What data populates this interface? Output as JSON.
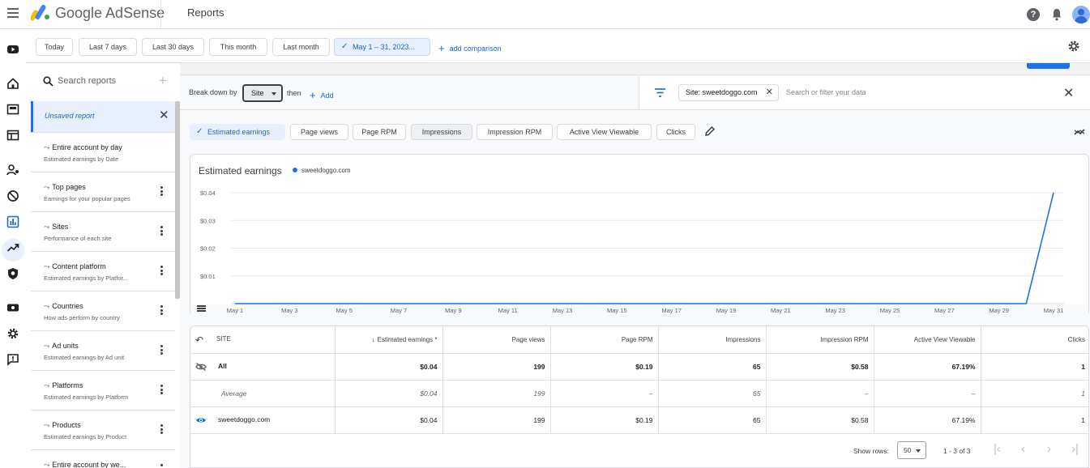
{
  "app": {
    "brand": "Google AdSense",
    "page_title": "Reports"
  },
  "date_bar": {
    "chips": [
      {
        "label": "Today"
      },
      {
        "label": "Last 7 days"
      },
      {
        "label": "Last 30 days"
      },
      {
        "label": "This month"
      },
      {
        "label": "Last month"
      },
      {
        "label": "May 1 – 31, 2023..."
      }
    ],
    "add_comparison": "add comparison"
  },
  "sidebar": {
    "search_label": "Search reports",
    "unsaved_label": "Unsaved report",
    "items": [
      {
        "title": "Entire account by day",
        "subtitle": "Estimated earnings by Date"
      },
      {
        "title": "Top pages",
        "subtitle": "Earnings for your popular pages"
      },
      {
        "title": "Sites",
        "subtitle": "Performance of each site"
      },
      {
        "title": "Content platform",
        "subtitle": "Estimated earnings by Platfor..."
      },
      {
        "title": "Countries",
        "subtitle": "How ads perform by country"
      },
      {
        "title": "Ad units",
        "subtitle": "Estimated earnings by Ad unit"
      },
      {
        "title": "Platforms",
        "subtitle": "Estimated earnings by Platform"
      },
      {
        "title": "Products",
        "subtitle": "Estimated earnings by Product"
      },
      {
        "title": "Entire account by we...",
        "subtitle": ""
      }
    ]
  },
  "breakdown": {
    "label": "Break down by",
    "dimension": "Site",
    "then": "then",
    "add": "Add"
  },
  "filter": {
    "chip": "Site: sweetdoggo.com",
    "placeholder": "Search or filter your data"
  },
  "metrics": [
    {
      "label": "Estimated earnings",
      "selected": true
    },
    {
      "label": "Page views",
      "selected": false
    },
    {
      "label": "Page RPM",
      "selected": false
    },
    {
      "label": "Impressions",
      "selected": false
    },
    {
      "label": "Impression RPM",
      "selected": false
    },
    {
      "label": "Active View Viewable",
      "selected": false
    },
    {
      "label": "Clicks",
      "selected": false
    }
  ],
  "chart": {
    "title": "Estimated earnings",
    "legend": "sweetdoggo.com",
    "series_color": "#1a73e8"
  },
  "chart_data": {
    "type": "line",
    "title": "Estimated earnings",
    "x": [
      "May 1",
      "May 2",
      "May 3",
      "May 4",
      "May 5",
      "May 6",
      "May 7",
      "May 8",
      "May 9",
      "May 10",
      "May 11",
      "May 12",
      "May 13",
      "May 14",
      "May 15",
      "May 16",
      "May 17",
      "May 18",
      "May 19",
      "May 20",
      "May 21",
      "May 22",
      "May 23",
      "May 24",
      "May 25",
      "May 26",
      "May 27",
      "May 28",
      "May 29",
      "May 30",
      "May 31"
    ],
    "x_tick_labels": [
      "May 1",
      "May 3",
      "May 5",
      "May 7",
      "May 9",
      "May 11",
      "May 13",
      "May 15",
      "May 17",
      "May 19",
      "May 21",
      "May 23",
      "May 25",
      "May 27",
      "May 29",
      "May 31"
    ],
    "y_tick_labels": [
      "$0.01",
      "$0.02",
      "$0.03",
      "$0.04"
    ],
    "ylim": [
      0,
      0.04
    ],
    "series": [
      {
        "name": "sweetdoggo.com",
        "values": [
          0,
          0,
          0,
          0,
          0,
          0,
          0,
          0,
          0,
          0,
          0,
          0,
          0,
          0,
          0,
          0,
          0,
          0,
          0,
          0,
          0,
          0,
          0,
          0,
          0,
          0,
          0,
          0,
          0,
          0,
          0.04
        ]
      }
    ],
    "grid": true,
    "legend_position": "top-left"
  },
  "table": {
    "headers": {
      "site": "SITE",
      "earnings": "Estimated earnings *",
      "page_views": "Page views",
      "page_rpm": "Page RPM",
      "impressions": "Impressions",
      "impression_rpm": "Impression RPM",
      "active_view": "Active View Viewable",
      "clicks": "Clicks"
    },
    "rows": [
      {
        "site": "All",
        "earnings": "$0.04",
        "page_views": "199",
        "page_rpm": "$0.19",
        "impressions": "65",
        "impression_rpm": "$0.58",
        "active_view": "67.19%",
        "clicks": "1"
      },
      {
        "site": "Average",
        "earnings": "$0.04",
        "page_views": "199",
        "page_rpm": "–",
        "impressions": "65",
        "impression_rpm": "–",
        "active_view": "–",
        "clicks": "1"
      },
      {
        "site": "sweetdoggo.com",
        "earnings": "$0.04",
        "page_views": "199",
        "page_rpm": "$0.19",
        "impressions": "65",
        "impression_rpm": "$0.58",
        "active_view": "67.19%",
        "clicks": "1"
      }
    ],
    "pager": {
      "show_rows": "Show rows:",
      "rows_value": "50",
      "range": "1 - 3 of 3"
    }
  }
}
